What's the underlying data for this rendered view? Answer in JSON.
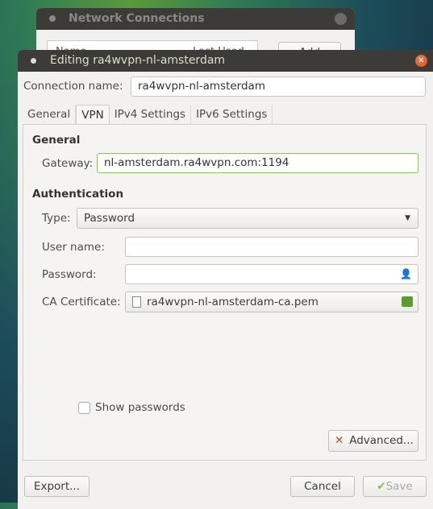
{
  "background_window": {
    "title": "Network Connections",
    "columns": [
      "Name",
      "Last Used"
    ],
    "add_label": "Add"
  },
  "dialog": {
    "title": "Editing ra4wvpn-nl-amsterdam",
    "connection_name_label": "Connection name:",
    "connection_name": "ra4wvpn-nl-amsterdam",
    "tabs": [
      {
        "label": "General"
      },
      {
        "label": "VPN",
        "active": true
      },
      {
        "label": "IPv4 Settings"
      },
      {
        "label": "IPv6 Settings"
      }
    ],
    "vpn": {
      "general_heading": "General",
      "gateway_label": "Gateway:",
      "gateway": "nl-amsterdam.ra4wvpn.com:1194",
      "auth_heading": "Authentication",
      "type_label": "Type:",
      "type_value": "Password",
      "username_label": "User name:",
      "username": "",
      "password_label": "Password:",
      "password": "",
      "ca_label": "CA Certificate:",
      "ca_file": "ra4wvpn-nl-amsterdam-ca.pem",
      "show_passwords_label": "Show passwords",
      "show_passwords": false,
      "advanced_label": "Advanced..."
    },
    "export_label": "Export...",
    "cancel_label": "Cancel",
    "save_label": "Save"
  },
  "colors": {
    "titlebar": "#3c3b37",
    "close": "#e0561f",
    "focus": "#8fc46a"
  }
}
